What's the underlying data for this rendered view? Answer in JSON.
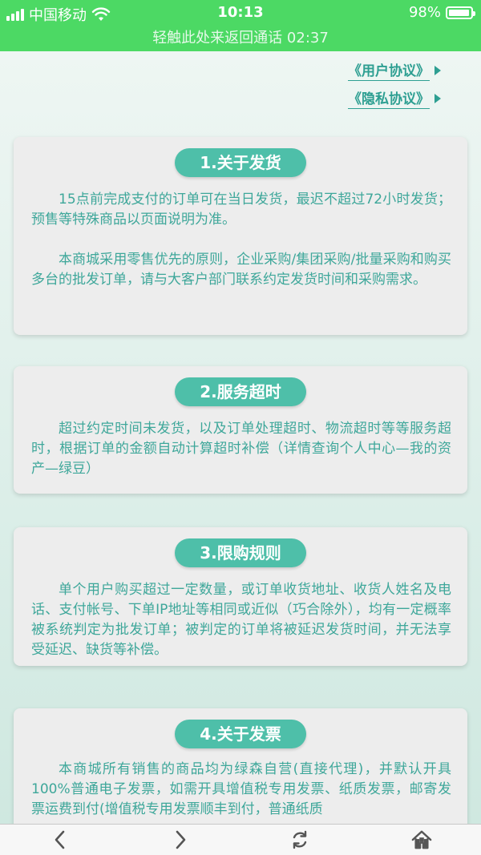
{
  "status": {
    "carrier": "中国移动",
    "time": "10:13",
    "battery": "98%",
    "battery_level": 0.98,
    "call_banner": "轻触此处来返回通话 02:37"
  },
  "links": {
    "user_agreement": "《用户协议》",
    "privacy_policy": "《隐私协议》"
  },
  "sections": [
    {
      "title": "1.关于发货",
      "paragraphs": [
        "15点前完成支付的订单可在当日发货，最迟不超过72小时发货；预售等特殊商品以页面说明为准。",
        "本商城采用零售优先的原则，企业采购/集团采购/批量采购和购买多台的批发订单，请与大客户部门联系约定发货时间和采购需求。"
      ]
    },
    {
      "title": "2.服务超时",
      "paragraphs": [
        "超过约定时间未发货，以及订单处理超时、物流超时等等服务超时，根据订单的金额自动计算超时补偿（详情查询个人中心—我的资产—绿豆）"
      ]
    },
    {
      "title": "3.限购规则",
      "paragraphs": [
        "单个用户购买超过一定数量，或订单收货地址、收货人姓名及电话、支付帐号、下单IP地址等相同或近似（巧合除外），均有一定概率被系统判定为批发订单；被判定的订单将被延迟发货时间，并无法享受延迟、缺货等补偿。"
      ]
    },
    {
      "title": "4.关于发票",
      "paragraphs": [
        "本商城所有销售的商品均为绿森自营(直接代理)，并默认开具100%普通电子发票，如需开具增值税专用发票、纸质发票，邮寄发票运费到付(增值税专用发票顺丰到付，普通纸质"
      ]
    }
  ],
  "toolbar": {
    "icons": [
      "back-icon",
      "forward-icon",
      "refresh-icon",
      "home-icon"
    ]
  },
  "colors": {
    "status_bar": "#4cd964",
    "accent": "#4ebfa9",
    "text": "#3ea79a",
    "card": "#ededed"
  }
}
